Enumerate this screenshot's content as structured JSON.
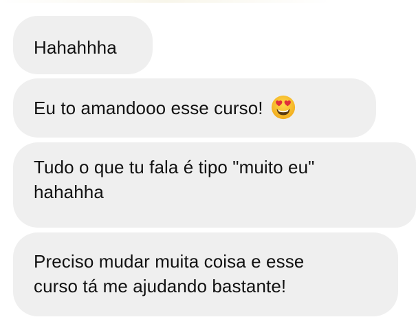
{
  "messages": [
    {
      "text": "Hahahhha"
    },
    {
      "text": "Eu to amandooo esse curso!",
      "emoji": "heart-eyes-emoji"
    },
    {
      "line1": "Tudo o que tu fala é tipo \"muito eu\"",
      "line2": "hahahha"
    },
    {
      "line1": "Preciso mudar muita coisa e esse",
      "line2": "curso tá me ajudando bastante!"
    }
  ],
  "colors": {
    "bubble_background": "#efefef",
    "text": "#111111",
    "emoji_face": "#f7c12e",
    "emoji_hearts": "#e0303a"
  }
}
